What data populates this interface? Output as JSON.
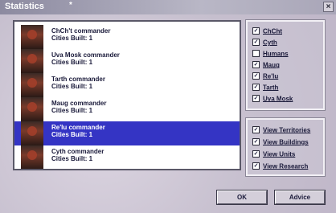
{
  "window": {
    "title": "Statistics",
    "title_marker": "*",
    "close_glyph": "×"
  },
  "list": {
    "rows": [
      {
        "name": "ChCh't commander",
        "detail": "Cities Built: 1",
        "selected": false
      },
      {
        "name": "Uva Mosk commander",
        "detail": "Cities Built: 1",
        "selected": false
      },
      {
        "name": "Tarth commander",
        "detail": "Cities Built: 1",
        "selected": false
      },
      {
        "name": "Maug commander",
        "detail": "Cities Built: 1",
        "selected": false
      },
      {
        "name": "Re'lu commander",
        "detail": "Cities Built: 1",
        "selected": true
      },
      {
        "name": "Cyth commander",
        "detail": "Cities Built: 1",
        "selected": false
      }
    ]
  },
  "races_filter": {
    "items": [
      {
        "label": "ChCht",
        "checked": true
      },
      {
        "label": "Cyth",
        "checked": true
      },
      {
        "label": "Humans",
        "checked": false
      },
      {
        "label": "Maug",
        "checked": true
      },
      {
        "label": "Re'lu",
        "checked": true
      },
      {
        "label": "Tarth",
        "checked": true
      },
      {
        "label": "Uva Mosk",
        "checked": true
      }
    ]
  },
  "view_filter": {
    "items": [
      {
        "label": "View Territories",
        "checked": true
      },
      {
        "label": "View Buildings",
        "checked": true
      },
      {
        "label": "View Units",
        "checked": true
      },
      {
        "label": "View Research",
        "checked": true
      }
    ]
  },
  "buttons": {
    "ok": "OK",
    "advice": "Advice"
  },
  "colors": {
    "selection": "#3434c4",
    "panel": "#ffffff",
    "text": "#1a1a3a"
  }
}
